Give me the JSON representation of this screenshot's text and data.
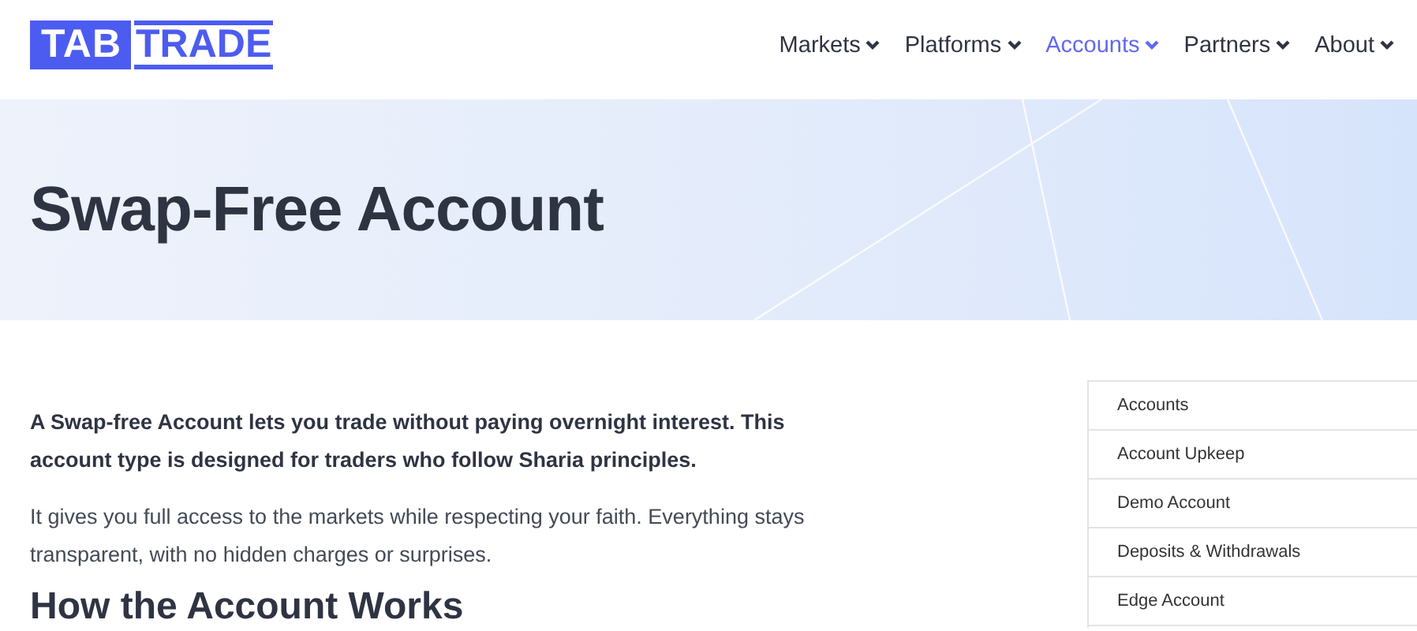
{
  "logo": {
    "left": "TAB",
    "right": "TRADE"
  },
  "nav": [
    {
      "label": "Markets",
      "selected": false
    },
    {
      "label": "Platforms",
      "selected": false
    },
    {
      "label": "Accounts",
      "selected": true
    },
    {
      "label": "Partners",
      "selected": false
    },
    {
      "label": "About",
      "selected": false
    }
  ],
  "hero": {
    "title": "Swap-Free Account"
  },
  "content": {
    "lead": "A Swap-free Account lets you trade without paying overnight interest. This account type is designed for traders who follow Sharia principles.",
    "body": "It gives you full access to the markets while respecting your faith. Everything stays transparent, with no hidden charges or surprises.",
    "heading": "How the Account Works"
  },
  "sidebar": {
    "items": [
      "Accounts",
      "Account Upkeep",
      "Demo Account",
      "Deposits & Withdrawals",
      "Edge Account"
    ]
  }
}
